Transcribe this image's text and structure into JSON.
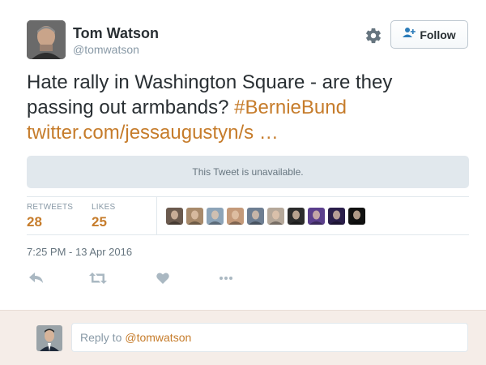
{
  "tweet": {
    "author": {
      "name": "Tom Watson",
      "handle": "@tomwatson"
    },
    "follow_label": "Follow",
    "text_plain": "Hate rally in Washington Square - are they passing out armbands?",
    "hashtag": "#BernieBund",
    "link": "twitter.com/jessaugustyn/s …",
    "unavailable_notice": "This Tweet is unavailable.",
    "stats": {
      "retweets_label": "RETWEETS",
      "retweets_count": "28",
      "likes_label": "LIKES",
      "likes_count": "25"
    },
    "likers": [
      {
        "name": "liker-1",
        "color": "#6b5a4e"
      },
      {
        "name": "liker-2",
        "color": "#a88a6b"
      },
      {
        "name": "liker-3",
        "color": "#8da4b8"
      },
      {
        "name": "liker-4",
        "color": "#c49a7a"
      },
      {
        "name": "liker-5",
        "color": "#6e7e92"
      },
      {
        "name": "liker-6",
        "color": "#b5a89a"
      },
      {
        "name": "liker-7",
        "color": "#2c2c2c"
      },
      {
        "name": "liker-8",
        "color": "#5b3f8c"
      },
      {
        "name": "liker-9",
        "color": "#2a1e4a"
      },
      {
        "name": "liker-10",
        "color": "#111111"
      }
    ],
    "timestamp": "7:25 PM - 13 Apr 2016",
    "actions": [
      "reply-icon",
      "retweet-icon",
      "like-icon",
      "more-icon"
    ],
    "accent_color": "#c67c2b"
  },
  "reply": {
    "prefix": "Reply to",
    "mention": "@tomwatson"
  }
}
